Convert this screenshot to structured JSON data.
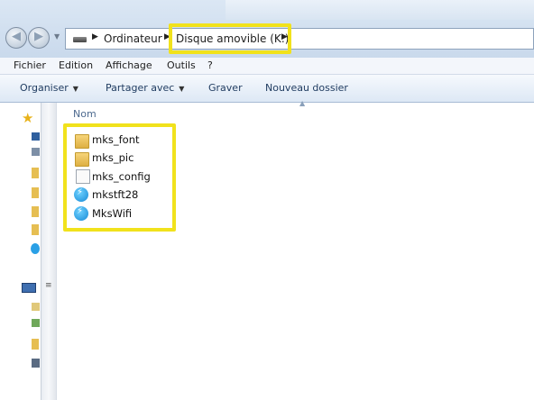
{
  "address": {
    "crumbs": [
      "Ordinateur",
      "Disque amovible (K:)"
    ],
    "drive_icon": "removable-drive-icon"
  },
  "menu": [
    "Fichier",
    "Edition",
    "Affichage",
    "Outils",
    "?"
  ],
  "toolbar": {
    "organize": "Organiser",
    "share": "Partager avec",
    "burn": "Graver",
    "new_folder": "Nouveau dossier"
  },
  "columns": {
    "name": "Nom"
  },
  "files": [
    {
      "name": "mks_font",
      "icon": "folder-icon"
    },
    {
      "name": "mks_pic",
      "icon": "folder-icon"
    },
    {
      "name": "mks_config",
      "icon": "file-icon"
    },
    {
      "name": "mkstft28",
      "icon": "app-icon"
    },
    {
      "name": "MksWifi",
      "icon": "app-icon"
    }
  ],
  "colors": {
    "highlight": "#f1e21c",
    "header_text": "#4d6a8f"
  }
}
